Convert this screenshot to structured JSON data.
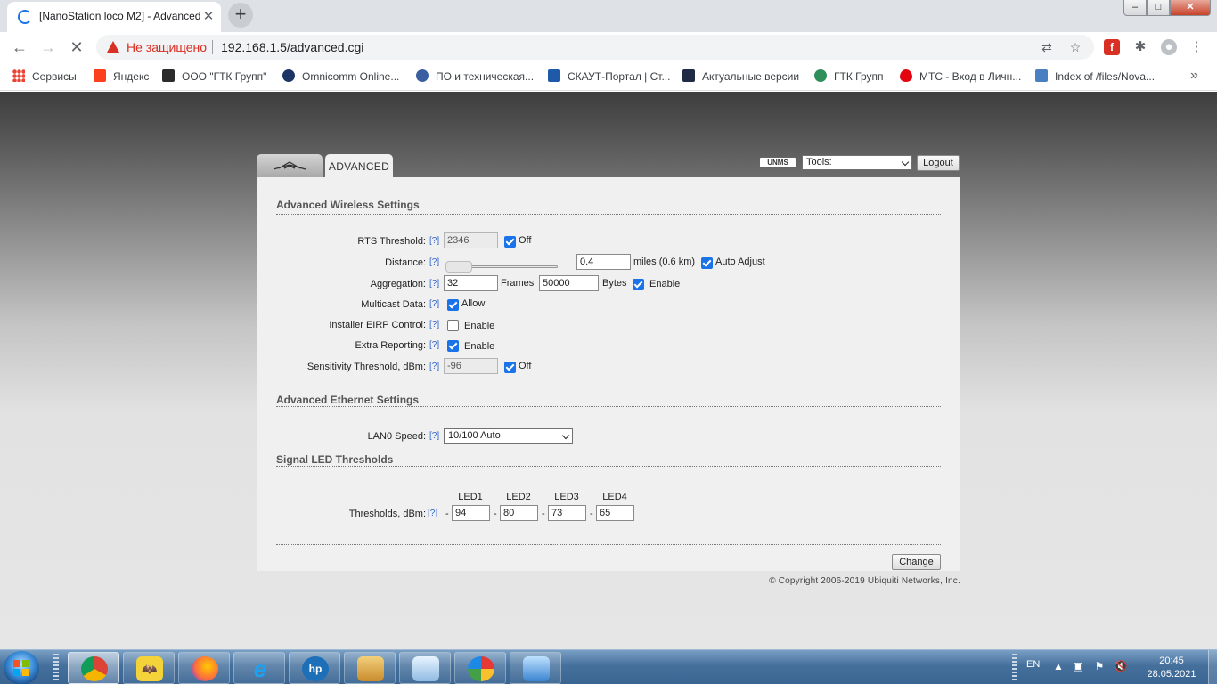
{
  "browser": {
    "tab_title": "[NanoStation loco M2] - Advanced",
    "tab_close": "✕",
    "new_tab": "+",
    "security_label": "Не защищено",
    "url": "192.168.1.5/advanced.cgi",
    "window_min": "–",
    "window_max": "□",
    "window_close": "✕"
  },
  "bookmarks": [
    {
      "label": "Сервисы",
      "icon": "apps-icon",
      "color": "#ea4335"
    },
    {
      "label": "Яндекс",
      "icon": "yandex-icon",
      "color": "#fc3f1d"
    },
    {
      "label": "ООО \"ГТК Групп\"",
      "icon": "gtk-icon",
      "color": "#2b2b2b"
    },
    {
      "label": "Omnicomm Online...",
      "icon": "omnicomm-icon",
      "color": "#1c3566"
    },
    {
      "label": "ПО и техническая...",
      "icon": "info-icon",
      "color": "#3a5fa0"
    },
    {
      "label": "СКАУТ-Портал | Ст...",
      "icon": "scout-icon",
      "color": "#1e5aa8"
    },
    {
      "label": "Актуальные версии",
      "icon": "versions-icon",
      "color": "#1f2a44"
    },
    {
      "label": "ГТК Групп",
      "icon": "gtk-globe-icon",
      "color": "#2f8f5b"
    },
    {
      "label": "МТС - Вход в Личн...",
      "icon": "mts-icon",
      "color": "#e30611"
    },
    {
      "label": "Index of /files/Nova...",
      "icon": "index-icon",
      "color": "#4a7fc1"
    }
  ],
  "bookmarks_more": "»",
  "airos": {
    "tab_label": "ADVANCED",
    "unms_label": "UNMS",
    "tools_selected": "Tools:",
    "logout_label": "Logout",
    "help_label": "[?]",
    "wireless": {
      "title": "Advanced Wireless Settings",
      "rts_label": "RTS Threshold:",
      "rts_value": "2346",
      "rts_off_label": "Off",
      "distance_label": "Distance:",
      "distance_value": "0.4",
      "distance_unit": "miles (0.6 km)",
      "auto_adjust_label": "Auto Adjust",
      "aggregation_label": "Aggregation:",
      "frames_value": "32",
      "frames_unit": "Frames",
      "bytes_value": "50000",
      "bytes_unit": "Bytes",
      "aggregation_enable_label": "Enable",
      "multicast_label": "Multicast Data:",
      "multicast_allow_label": "Allow",
      "eirp_label": "Installer EIRP Control:",
      "eirp_enable_label": "Enable",
      "extra_label": "Extra Reporting:",
      "extra_enable_label": "Enable",
      "sensitivity_label": "Sensitivity Threshold, dBm:",
      "sensitivity_value": "-96",
      "sensitivity_off_label": "Off"
    },
    "ethernet": {
      "title": "Advanced Ethernet Settings",
      "lan_label": "LAN0 Speed:",
      "lan_selected": "10/100 Auto"
    },
    "led": {
      "title": "Signal LED Thresholds",
      "thresholds_label": "Thresholds, dBm:",
      "dash": "-",
      "headers": [
        "LED1",
        "LED2",
        "LED3",
        "LED4"
      ],
      "values": [
        "94",
        "80",
        "73",
        "65"
      ]
    },
    "change_label": "Change",
    "copyright": "© Copyright 2006-2019 Ubiquiti Networks, Inc."
  },
  "taskbar": {
    "apps": [
      "chrome-icon",
      "batman-icon",
      "firefox-icon",
      "ie-icon",
      "hp-icon",
      "files-icon",
      "notepad-icon",
      "paint-icon",
      "control-panel-icon"
    ],
    "language": "EN",
    "time": "20:45",
    "date": "28.05.2021"
  }
}
